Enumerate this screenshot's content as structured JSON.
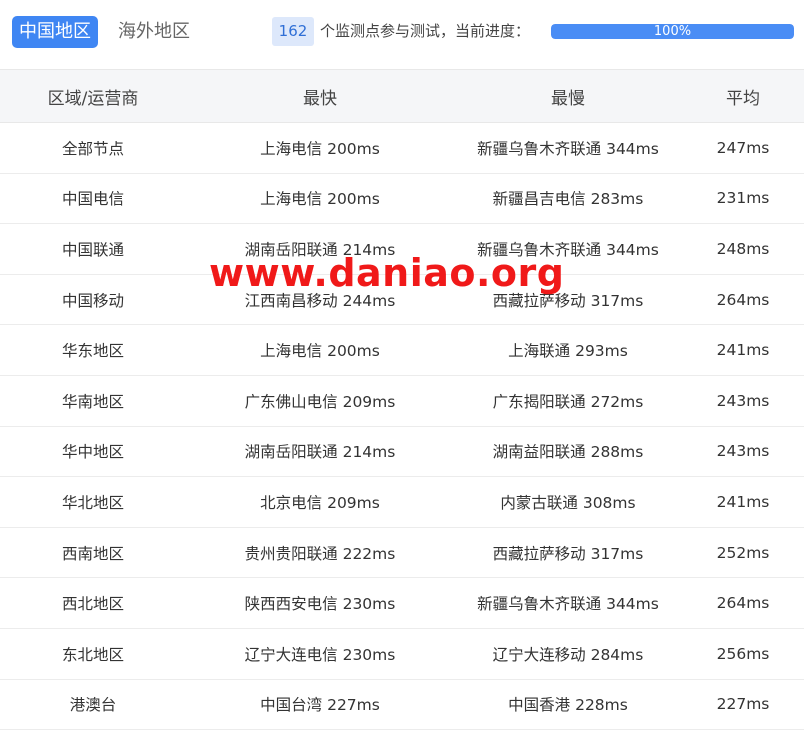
{
  "tabs": [
    {
      "label": "中国地区",
      "active": true
    },
    {
      "label": "海外地区",
      "active": false
    }
  ],
  "progress": {
    "count": "162",
    "text": "个监测点参与测试，当前进度：",
    "percent_label": "100%",
    "percent_value": 100
  },
  "table": {
    "headers": [
      "区域/运营商",
      "最快",
      "最慢",
      "平均"
    ],
    "rows": [
      [
        "全部节点",
        "上海电信 200ms",
        "新疆乌鲁木齐联通 344ms",
        "247ms"
      ],
      [
        "中国电信",
        "上海电信 200ms",
        "新疆昌吉电信 283ms",
        "231ms"
      ],
      [
        "中国联通",
        "湖南岳阳联通 214ms",
        "新疆乌鲁木齐联通 344ms",
        "248ms"
      ],
      [
        "中国移动",
        "江西南昌移动 244ms",
        "西藏拉萨移动 317ms",
        "264ms"
      ],
      [
        "华东地区",
        "上海电信 200ms",
        "上海联通 293ms",
        "241ms"
      ],
      [
        "华南地区",
        "广东佛山电信 209ms",
        "广东揭阳联通 272ms",
        "243ms"
      ],
      [
        "华中地区",
        "湖南岳阳联通 214ms",
        "湖南益阳联通 288ms",
        "243ms"
      ],
      [
        "华北地区",
        "北京电信 209ms",
        "内蒙古联通 308ms",
        "241ms"
      ],
      [
        "西南地区",
        "贵州贵阳联通 222ms",
        "西藏拉萨移动 317ms",
        "252ms"
      ],
      [
        "西北地区",
        "陕西西安电信 230ms",
        "新疆乌鲁木齐联通 344ms",
        "264ms"
      ],
      [
        "东北地区",
        "辽宁大连电信 230ms",
        "辽宁大连移动 284ms",
        "256ms"
      ],
      [
        "港澳台",
        "中国台湾 227ms",
        "中国香港 228ms",
        "227ms"
      ]
    ]
  },
  "watermark": "www.daniao.org",
  "colors": {
    "accent": "#3f86f3",
    "progress_fill": "#4a8df5",
    "badge_bg": "#dde8fb",
    "watermark": "#f01919"
  }
}
